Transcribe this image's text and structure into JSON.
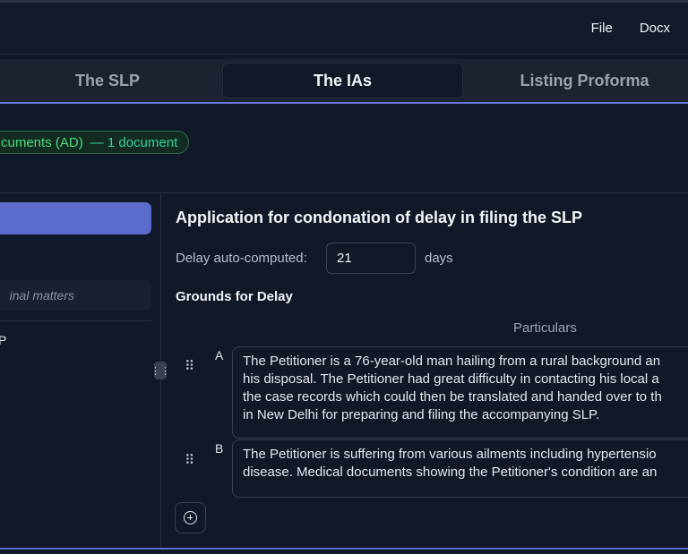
{
  "menu": {
    "file": "File",
    "docx": "Docx"
  },
  "tabs": [
    {
      "label": "The SLP"
    },
    {
      "label": "The IAs",
      "active": true
    },
    {
      "label": "Listing Proforma"
    }
  ],
  "annexure_pill": {
    "label": "cuments (AD)",
    "count": "— 1 document"
  },
  "sidebar": {
    "search_placeholder": "inal matters",
    "item": "P"
  },
  "main": {
    "title": "Application for condonation of delay in filing the SLP",
    "delay_label": "Delay auto-computed:",
    "delay_value": "21",
    "delay_unit": "days",
    "grounds_heading": "Grounds for Delay",
    "column_header": "Particulars",
    "grounds": [
      {
        "letter": "A",
        "lines": [
          "The Petitioner is a 76-year-old man hailing from a rural background an",
          "his disposal. The Petitioner had great difficulty in contacting his local a",
          "the case records which could then be translated and handed over to th",
          "in New Delhi for preparing and filing the accompanying SLP."
        ]
      },
      {
        "letter": "B",
        "lines": [
          "The Petitioner is suffering from various ailments including hypertensio",
          "disease. Medical documents showing the Petitioner's condition are an"
        ]
      }
    ]
  },
  "icons": {
    "drag": "drag-handle-icon",
    "add": "add-circle-icon",
    "resize": "resize-handle-icon"
  },
  "colors": {
    "accent": "#6674d9",
    "active_sidebar": "#5b6ccc",
    "pill_text": "#4ade80",
    "background": "#111827"
  }
}
